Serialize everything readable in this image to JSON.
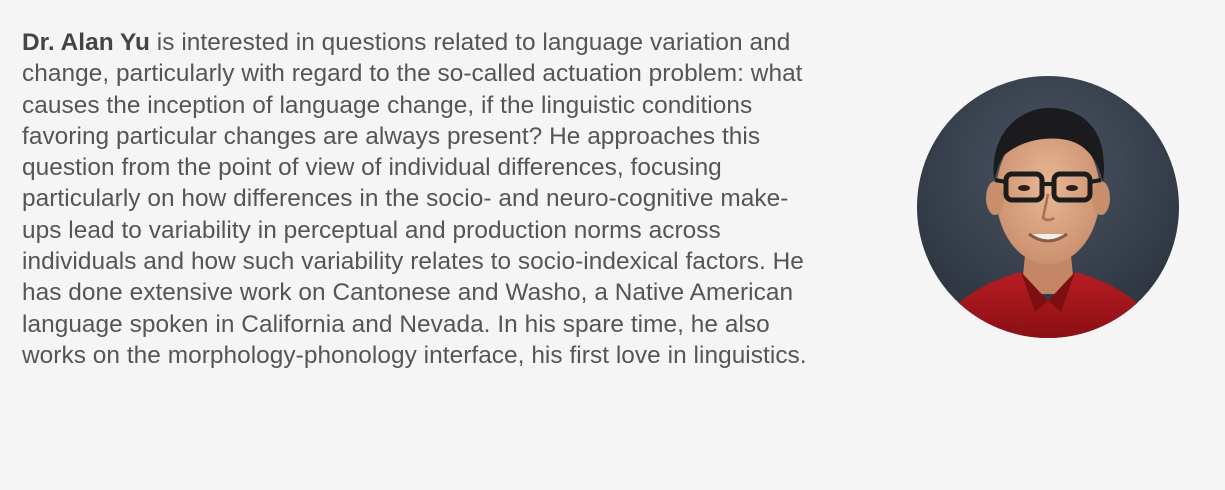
{
  "profile": {
    "name": "Dr. Alan Yu",
    "bio": " is interested in questions related to language variation and change, particularly with regard to the so-called actuation problem: what causes the inception of language change, if the linguistic conditions favoring particular changes are always present? He approaches this question from the point of view of individual differences, focusing particularly on how differences in the socio- and neuro-cognitive make-ups lead to variability in perceptual and production norms across individuals and how such variability relates to socio-indexical factors. He has done extensive work on Cantonese and Washo, a Native American language spoken in California and Nevada. In his spare time, he also works on the morphology-phonology interface, his first love in linguistics.",
    "photo_icon": "portrait-photo"
  },
  "colors": {
    "background": "#f5f5f5",
    "text": "#555555",
    "name_text": "#444444",
    "photo_backdrop": "#3b4351",
    "shirt": "#a8151c"
  }
}
